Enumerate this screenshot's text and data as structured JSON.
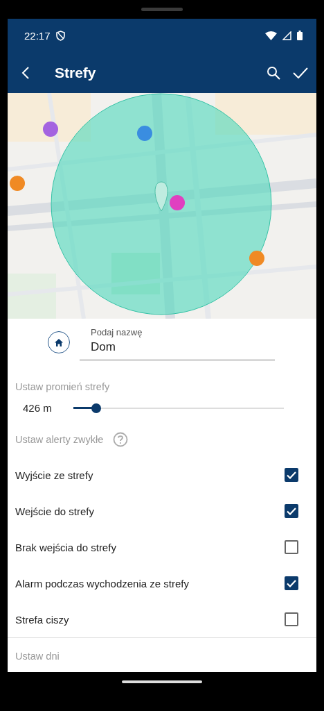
{
  "status_bar": {
    "time": "22:17"
  },
  "app_bar": {
    "title": "Strefy"
  },
  "name_field": {
    "label": "Podaj nazwę",
    "value": "Dom"
  },
  "radius": {
    "heading": "Ustaw promień strefy",
    "reading": "426 m",
    "level": 0.11
  },
  "alerts": {
    "heading": "Ustaw alerty zwykłe",
    "items": [
      {
        "label": "Wyjście ze strefy",
        "checked": true
      },
      {
        "label": "Wejście do strefy",
        "checked": true
      },
      {
        "label": "Brak wejścia do strefy",
        "checked": false
      },
      {
        "label": "Alarm podczas wychodzenia ze strefy",
        "checked": true
      },
      {
        "label": "Strefa ciszy",
        "checked": false
      }
    ]
  },
  "days": {
    "heading": "Ustaw dni"
  }
}
